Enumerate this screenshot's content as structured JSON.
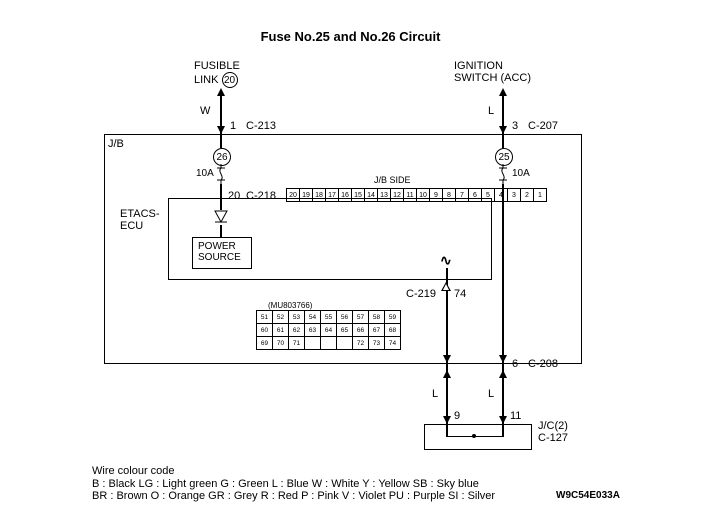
{
  "title": "Fuse No.25 and No.26 Circuit",
  "source_left": {
    "line1": "FUSIBLE",
    "line2": "LINK",
    "num": "20"
  },
  "source_right": {
    "line1": "IGNITION",
    "line2": "SWITCH (ACC)"
  },
  "wires": {
    "W": "W",
    "L": "L"
  },
  "conn": {
    "c213": {
      "pin": "1",
      "label": "C-213"
    },
    "c207": {
      "pin": "3",
      "label": "C-207"
    },
    "c218": {
      "pin": "20",
      "label": "C-218"
    },
    "c219": {
      "label": "C-219",
      "pin": "74"
    },
    "c208": {
      "pin": "6",
      "label": "C-208"
    },
    "c127_a": {
      "pin": "9"
    },
    "c127_b": {
      "pin": "11"
    },
    "jc": {
      "label1": "J/C(2)",
      "label2": "C-127"
    }
  },
  "jb": "J/B",
  "jb_side": "J/B SIDE",
  "fuses": {
    "f26": {
      "num": "26",
      "rating": "10A"
    },
    "f25": {
      "num": "25",
      "rating": "10A"
    }
  },
  "etacs": "ETACS-\nECU",
  "power_source": "POWER\nSOURCE",
  "partnum": "(MU803766)",
  "conn20cells": [
    "20",
    "19",
    "18",
    "17",
    "16",
    "15",
    "14",
    "13",
    "12",
    "11",
    "10",
    "9",
    "8",
    "7",
    "6",
    "5",
    "4",
    "3",
    "2",
    "1"
  ],
  "gridrows": [
    [
      "51",
      "52",
      "53",
      "54",
      "55",
      "56",
      "57",
      "58",
      "59"
    ],
    [
      "60",
      "61",
      "62",
      "63",
      "64",
      "65",
      "66",
      "67",
      "68"
    ],
    [
      "69",
      "70",
      "71",
      "",
      "",
      "",
      "72",
      "73",
      "74"
    ]
  ],
  "legend": {
    "title": "Wire colour code",
    "row1": "B : Black    LG : Light green    G : Green    L : Blue    W : White    Y : Yellow    SB : Sky blue",
    "row2": "BR : Brown    O : Orange    GR : Grey    R : Red    P : Pink    V : Violet    PU : Purple    SI : Silver"
  },
  "docid": "W9C54E033A"
}
